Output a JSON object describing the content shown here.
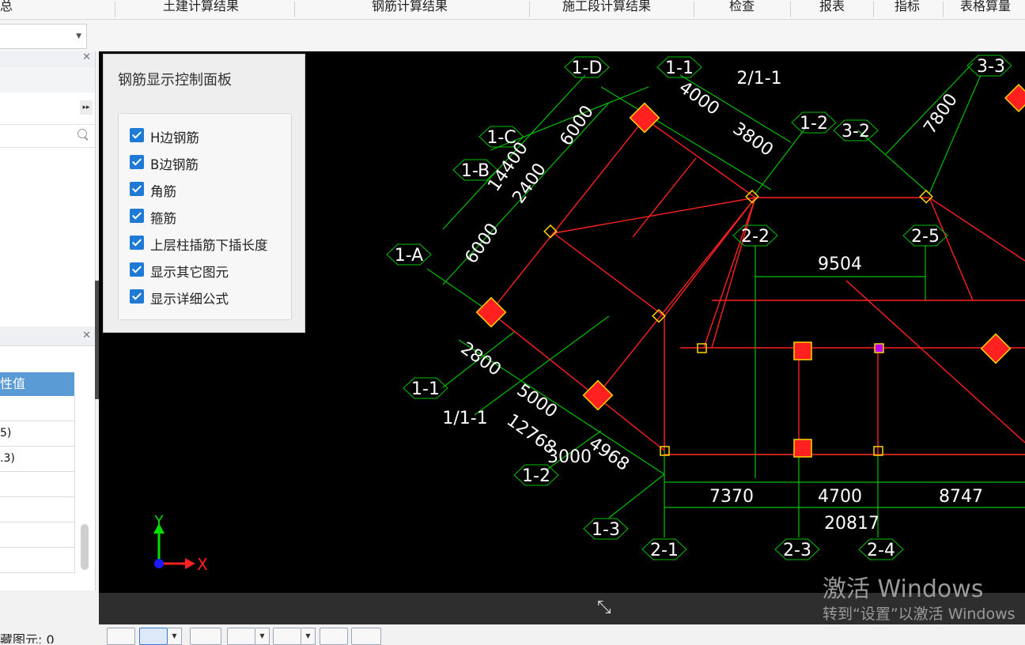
{
  "menu": [
    "总",
    "土建计算结果",
    "钢筋计算结果",
    "施工段计算结果",
    "检查",
    "报表",
    "指标",
    "表格算量"
  ],
  "left_panel": {
    "prop_header": "性值",
    "prop_rows": [
      "",
      "5)",
      ".3)",
      "",
      "",
      "",
      ""
    ]
  },
  "rebar_panel": {
    "title": "钢筋显示控制面板",
    "options": [
      {
        "label": "H边钢筋",
        "checked": true
      },
      {
        "label": "B边钢筋",
        "checked": true
      },
      {
        "label": "角筋",
        "checked": true
      },
      {
        "label": "箍筋",
        "checked": true
      },
      {
        "label": "上层柱插筋下插长度",
        "checked": true
      },
      {
        "label": "显示其它图元",
        "checked": true
      },
      {
        "label": "显示详细公式",
        "checked": true
      }
    ]
  },
  "axis_labels": {
    "a1D": "1-D",
    "a11": "1-1",
    "a211": "2/1-1",
    "a12": "1-2",
    "a32": "3-2",
    "a33": "3-3",
    "a1C": "1-C",
    "a1B": "1-B",
    "a1A": "1-A",
    "a22": "2-2",
    "a25": "2-5",
    "a11b": "1-1",
    "a111": "1/1-1",
    "a12b": "1-2",
    "a13": "1-3",
    "a21": "2-1",
    "a23": "2-3",
    "a24": "2-4"
  },
  "dimensions": {
    "d4000": "4000",
    "d3800": "3800",
    "d6000a": "6000",
    "d14400": "14400",
    "d2400": "2400",
    "d6000b": "6000",
    "d7800": "7800",
    "d9504": "9504",
    "d2800": "2800",
    "d5000": "5000",
    "d12768": "12768",
    "d3000": "3000",
    "d4968": "4968",
    "d7370": "7370",
    "d4700": "4700",
    "d8747": "8747",
    "d20817": "20817"
  },
  "coord_axes": {
    "y": "Y",
    "x": "X"
  },
  "status": {
    "watermark_title": "激活 Windows",
    "watermark_sub": "转到“设置”以激活 Windows",
    "hidden_count": "藏图元: 0"
  },
  "colors": {
    "grid_line": "#00c000",
    "beam_line": "#ff2020",
    "axis_bubble_text": "#ffffff",
    "column_fill": "#ff2020",
    "column_border": "#ffd400",
    "checkbox": "#1f7ad6",
    "selected_column": "#c000ff"
  }
}
